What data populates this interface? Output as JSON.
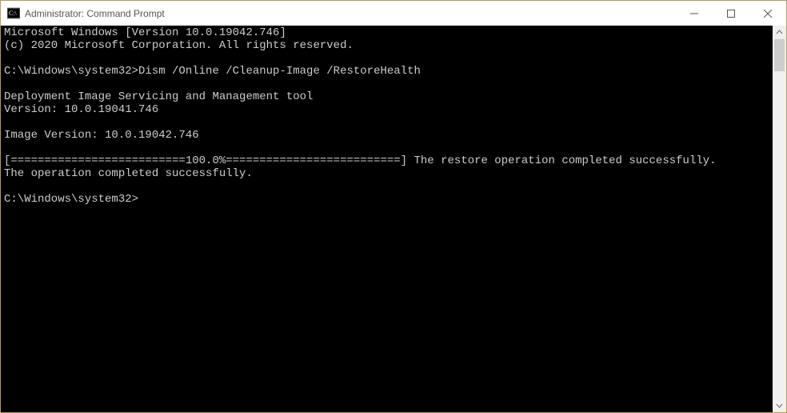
{
  "window": {
    "title": "Administrator: Command Prompt"
  },
  "terminal": {
    "lines": [
      "Microsoft Windows [Version 10.0.19042.746]",
      "(c) 2020 Microsoft Corporation. All rights reserved.",
      "",
      "C:\\Windows\\system32>Dism /Online /Cleanup-Image /RestoreHealth",
      "",
      "Deployment Image Servicing and Management tool",
      "Version: 10.0.19041.746",
      "",
      "Image Version: 10.0.19042.746",
      "",
      "[==========================100.0%==========================] The restore operation completed successfully.",
      "The operation completed successfully.",
      "",
      "C:\\Windows\\system32>"
    ]
  }
}
